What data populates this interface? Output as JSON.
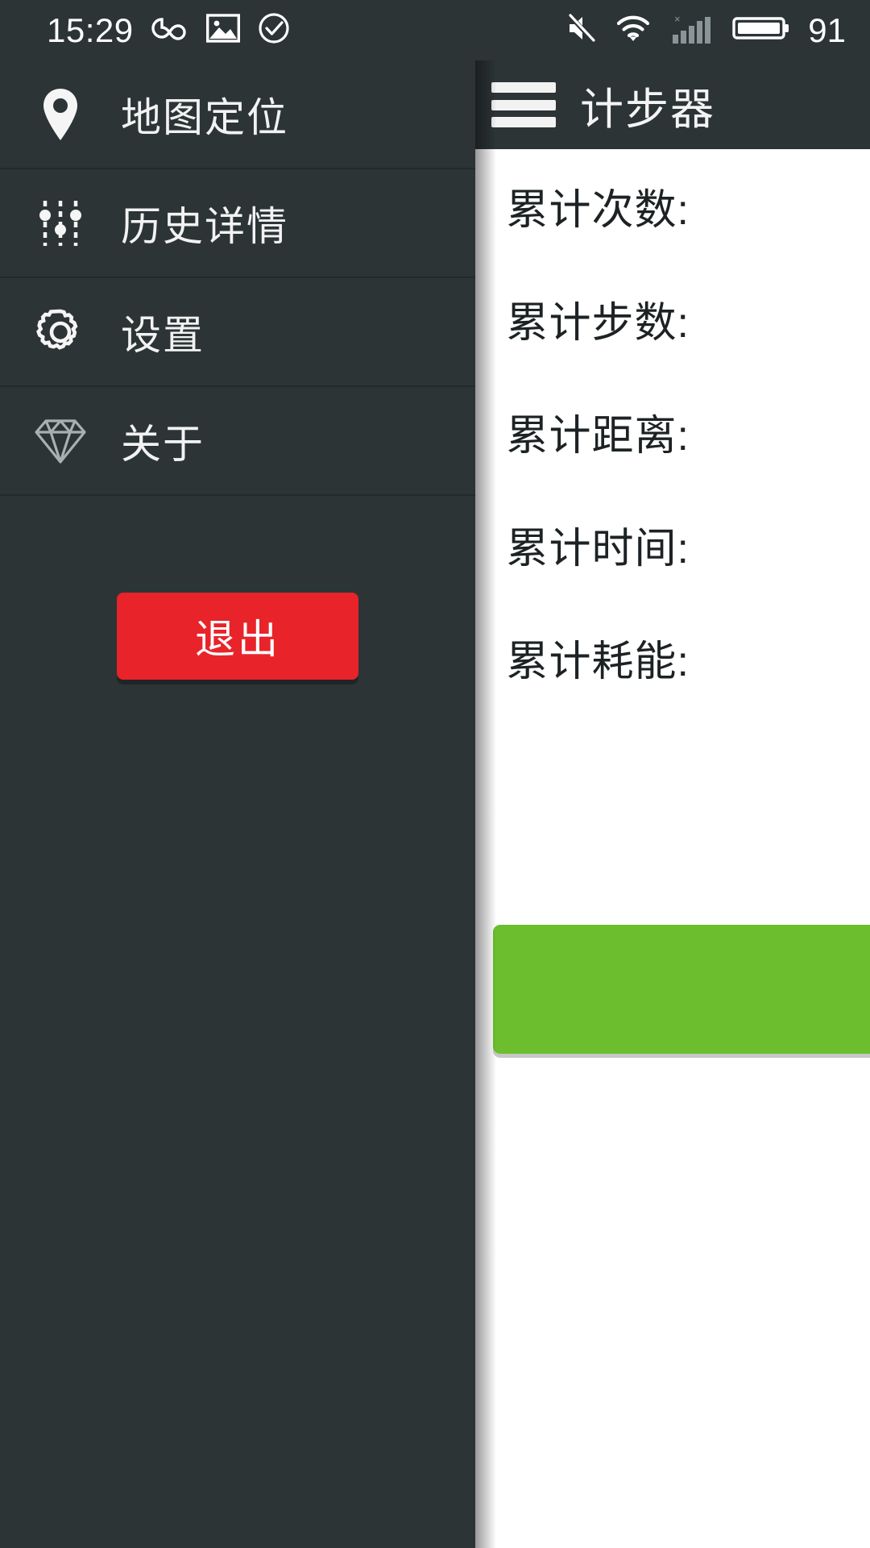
{
  "status_bar": {
    "clock": "15:29",
    "battery_percent": "91",
    "icons": [
      "infinity-icon",
      "image-icon",
      "check-circle-icon",
      "mute-icon",
      "wifi-icon",
      "signal-bars-icon",
      "battery-icon"
    ]
  },
  "app": {
    "title": "计步器",
    "menu_icon": "hamburger-menu-icon"
  },
  "stats": [
    {
      "label": "累计次数:",
      "value": ""
    },
    {
      "label": "累计步数:",
      "value": ""
    },
    {
      "label": "累计距离:",
      "value": ""
    },
    {
      "label": "累计时间:",
      "value": ""
    },
    {
      "label": "累计耗能:",
      "value": ""
    }
  ],
  "start_button": {
    "label": ""
  },
  "drawer": {
    "items": [
      {
        "label": "地图定位",
        "icon": "map-pin-icon"
      },
      {
        "label": "历史详情",
        "icon": "sliders-icon"
      },
      {
        "label": "设置",
        "icon": "gear-icon"
      },
      {
        "label": "关于",
        "icon": "diamond-icon"
      }
    ],
    "exit_label": "退出"
  },
  "colors": {
    "drawer_bg": "#2c3436",
    "appbar_bg": "#2c3436",
    "exit_red": "#e8232a",
    "start_green": "#6cbe2e",
    "content_bg": "#ffffff",
    "text_light": "#f2f2f2",
    "text_dark": "#1d2224"
  }
}
